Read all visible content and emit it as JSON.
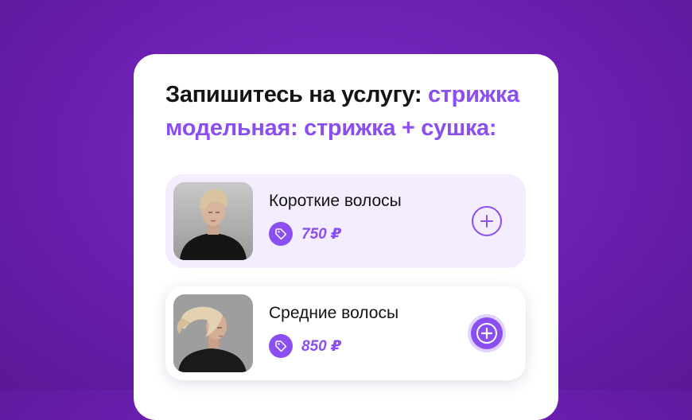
{
  "card": {
    "heading_black": "Запишитесь на услугу: ",
    "heading_accent": "стрижка модельная: стрижка + сушка:"
  },
  "services": [
    {
      "name": "Короткие волосы",
      "price": "750 ₽",
      "photo": "short-hair-woman-photo",
      "button_state": "outline"
    },
    {
      "name": "Средние волосы",
      "price": "850 ₽",
      "photo": "medium-hair-woman-photo",
      "button_state": "filled"
    }
  ],
  "colors": {
    "background": "#6a1fb0",
    "accent": "#8b4ef0",
    "selected_row": "#f4edff"
  },
  "icons": {
    "price": "price-tag-icon",
    "add": "plus-circle-icon"
  }
}
